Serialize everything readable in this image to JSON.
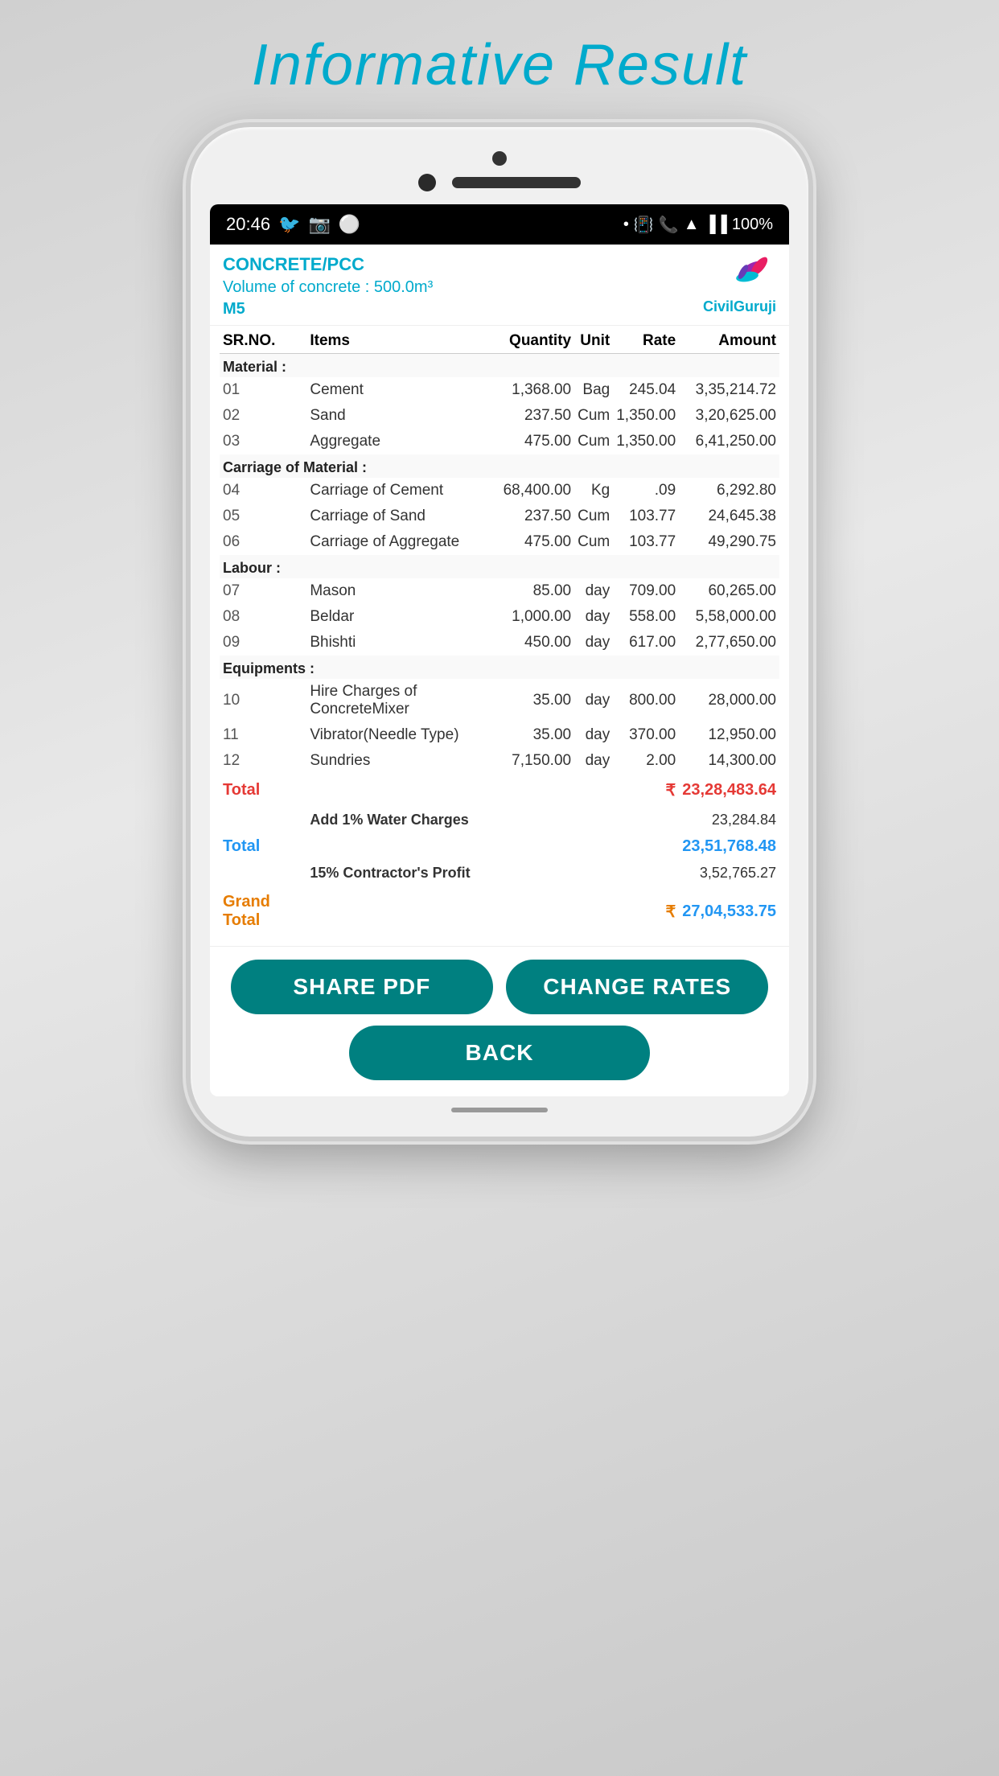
{
  "page": {
    "title": "Informative Result"
  },
  "status_bar": {
    "time": "20:46",
    "battery": "100%"
  },
  "app_header": {
    "title": "CONCRETE/PCC",
    "subtitle": "Volume of concrete : 500.0m³",
    "grade": "M5"
  },
  "logo": {
    "brand": "CivilGuruji"
  },
  "table": {
    "columns": [
      "SR.NO.",
      "Items",
      "Quantity",
      "Unit",
      "Rate",
      "Amount"
    ],
    "sections": [
      {
        "name": "Material :",
        "rows": [
          {
            "sr": "01",
            "item": "Cement",
            "quantity": "1,368.00",
            "unit": "Bag",
            "rate": "245.04",
            "amount": "3,35,214.72"
          },
          {
            "sr": "02",
            "item": "Sand",
            "quantity": "237.50",
            "unit": "Cum",
            "rate": "1,350.00",
            "amount": "3,20,625.00"
          },
          {
            "sr": "03",
            "item": "Aggregate",
            "quantity": "475.00",
            "unit": "Cum",
            "rate": "1,350.00",
            "amount": "6,41,250.00"
          }
        ]
      },
      {
        "name": "Carriage of Material :",
        "rows": [
          {
            "sr": "04",
            "item": "Carriage of Cement",
            "quantity": "68,400.00",
            "unit": "Kg",
            "rate": ".09",
            "amount": "6,292.80"
          },
          {
            "sr": "05",
            "item": "Carriage of Sand",
            "quantity": "237.50",
            "unit": "Cum",
            "rate": "103.77",
            "amount": "24,645.38"
          },
          {
            "sr": "06",
            "item": "Carriage of Aggregate",
            "quantity": "475.00",
            "unit": "Cum",
            "rate": "103.77",
            "amount": "49,290.75"
          }
        ]
      },
      {
        "name": "Labour :",
        "rows": [
          {
            "sr": "07",
            "item": "Mason",
            "quantity": "85.00",
            "unit": "day",
            "rate": "709.00",
            "amount": "60,265.00"
          },
          {
            "sr": "08",
            "item": "Beldar",
            "quantity": "1,000.00",
            "unit": "day",
            "rate": "558.00",
            "amount": "5,58,000.00"
          },
          {
            "sr": "09",
            "item": "Bhishti",
            "quantity": "450.00",
            "unit": "day",
            "rate": "617.00",
            "amount": "2,77,650.00"
          }
        ]
      },
      {
        "name": "Equipments :",
        "rows": [
          {
            "sr": "10",
            "item": "Hire Charges of ConcreteMixer",
            "quantity": "35.00",
            "unit": "day",
            "rate": "800.00",
            "amount": "28,000.00"
          },
          {
            "sr": "11",
            "item": "Vibrator(Needle Type)",
            "quantity": "35.00",
            "unit": "day",
            "rate": "370.00",
            "amount": "12,950.00"
          },
          {
            "sr": "12",
            "item": "Sundries",
            "quantity": "7,150.00",
            "unit": "day",
            "rate": "2.00",
            "amount": "14,300.00"
          }
        ]
      }
    ],
    "total_label": "Total",
    "total_rupee": "₹",
    "total_amount": "23,28,483.64",
    "water_charges_label": "Add 1% Water Charges",
    "water_charges_amount": "23,284.84",
    "subtotal_label": "Total",
    "subtotal_amount": "23,51,768.48",
    "profit_label": "15% Contractor's Profit",
    "profit_amount": "3,52,765.27",
    "grand_total_label": "Grand Total",
    "grand_total_rupee": "₹",
    "grand_total_amount": "27,04,533.75"
  },
  "buttons": {
    "share_pdf": "SHARE PDF",
    "change_rates": "CHANGE RATES",
    "back": "BACK"
  }
}
